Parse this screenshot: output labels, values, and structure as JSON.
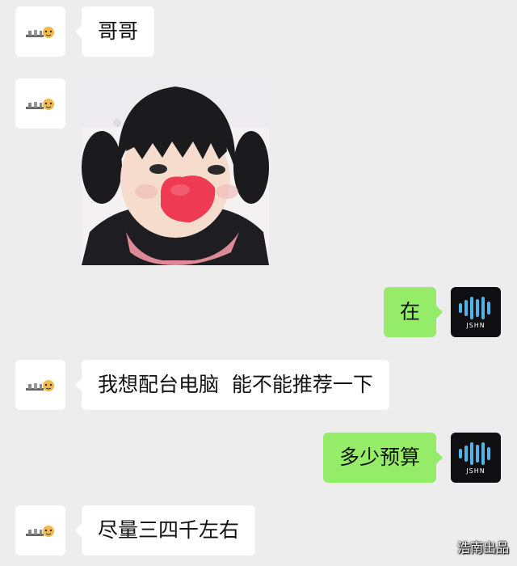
{
  "messages": [
    {
      "sender": "friend",
      "text": "哥哥"
    },
    {
      "sender": "friend",
      "type": "image"
    },
    {
      "sender": "self",
      "text": "在"
    },
    {
      "sender": "friend",
      "text": "我想配台电脑  能不能推荐一下"
    },
    {
      "sender": "self",
      "text": "多少预算"
    },
    {
      "sender": "friend",
      "text": "尽量三四千左右"
    }
  ],
  "self_avatar": {
    "label": "JSHN"
  },
  "watermark": "浩南出品",
  "colors": {
    "background": "#ededed",
    "self_bubble": "#95ec69",
    "friend_bubble": "#ffffff"
  }
}
